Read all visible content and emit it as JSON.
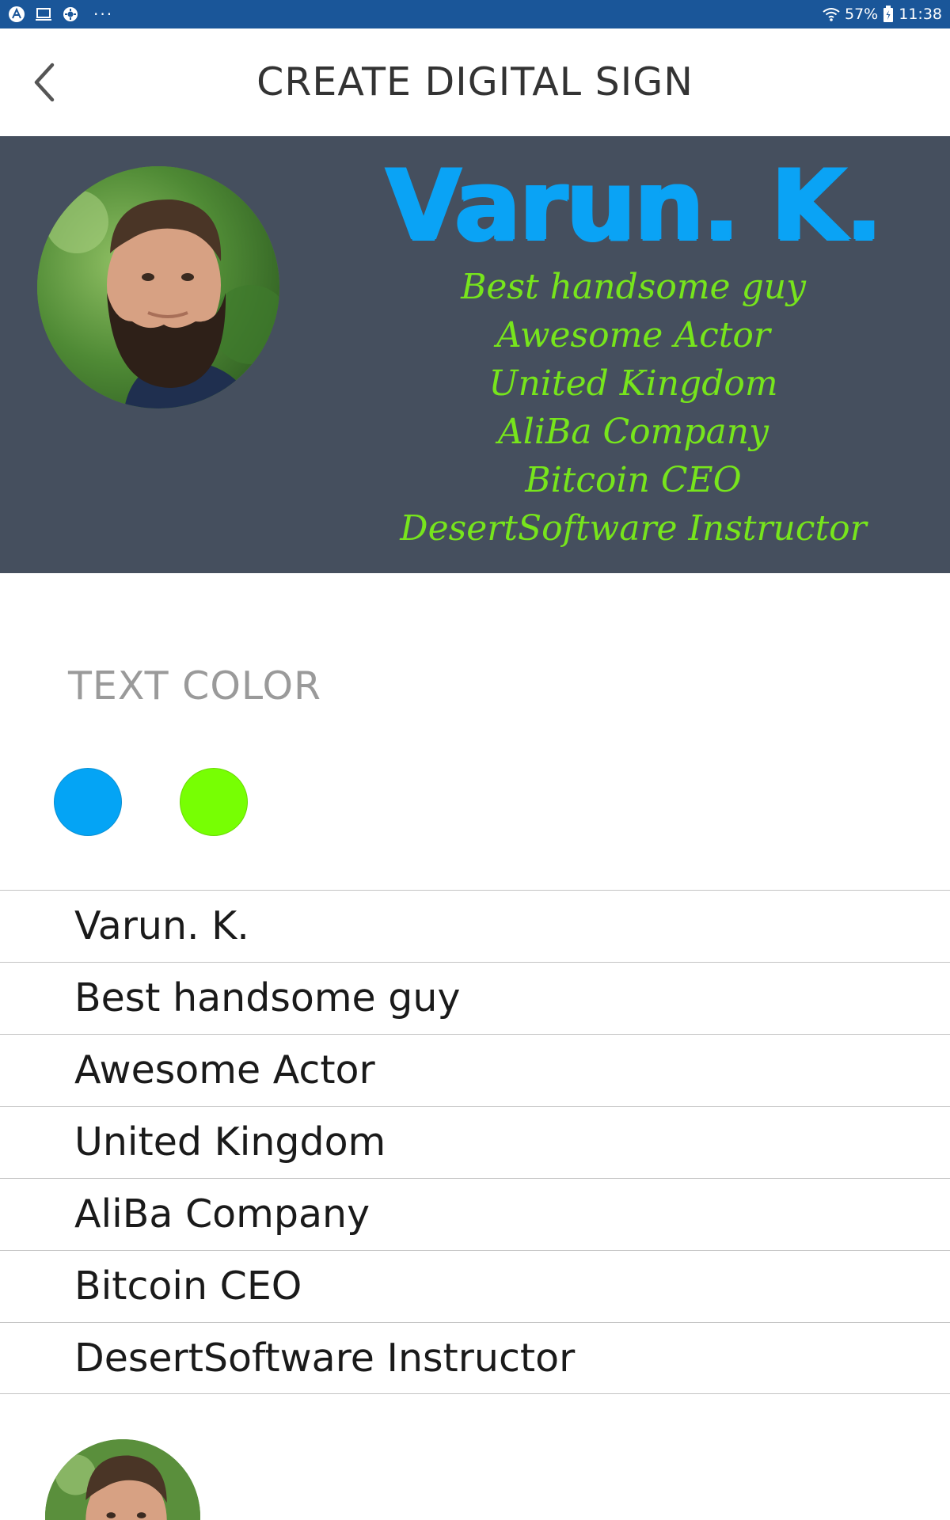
{
  "status_bar": {
    "battery": "57%",
    "time": "11:38",
    "overflow": "···",
    "icons": [
      "app-notification-icon",
      "screen-mirror-icon",
      "settings-notification-icon",
      "wifi-icon",
      "battery-icon"
    ]
  },
  "header": {
    "title": "CREATE DIGITAL SIGN",
    "back_icon": "chevron-left-icon"
  },
  "banner": {
    "name": "Varun. K.",
    "lines": [
      "Best handsome guy",
      "Awesome Actor",
      "United Kingdom",
      "AliBa Company",
      "Bitcoin CEO",
      "DesertSoftware Instructor"
    ],
    "background_color": "#454f5e",
    "name_color": "#0aa3f5",
    "lines_color": "#77e51c",
    "photo": "profile-photo"
  },
  "text_color": {
    "label": "TEXT COLOR",
    "options": [
      "#04a4f5",
      "#77ff03"
    ]
  },
  "fields": [
    "Varun. K.",
    "Best handsome guy",
    "Awesome Actor",
    "United Kingdom",
    "AliBa Company",
    "Bitcoin CEO",
    "DesertSoftware Instructor"
  ],
  "photo_picker": "profile-photo"
}
